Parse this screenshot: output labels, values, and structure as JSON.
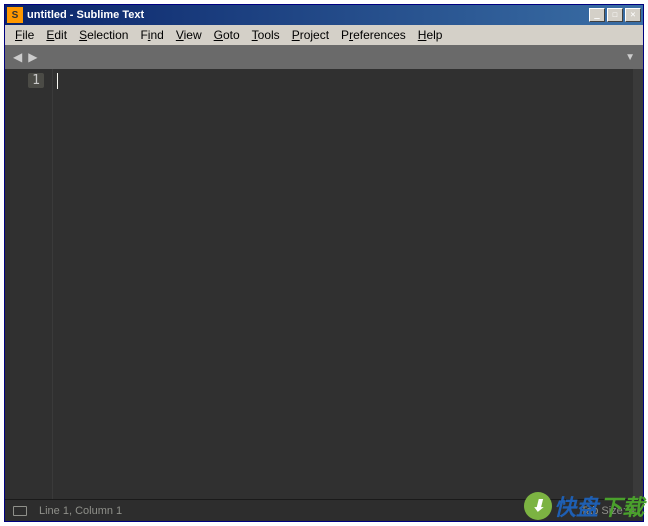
{
  "titlebar": {
    "text": "untitled - Sublime Text"
  },
  "menu": {
    "file": "File",
    "edit": "Edit",
    "selection": "Selection",
    "find": "Find",
    "view": "View",
    "goto": "Goto",
    "tools": "Tools",
    "project": "Project",
    "preferences": "Preferences",
    "help": "Help"
  },
  "gutter": {
    "line1": "1"
  },
  "status": {
    "position": "Line 1, Column 1",
    "tabsize": "Tab Size: 4"
  },
  "watermark": {
    "text1": "快盘",
    "text2": "下载"
  }
}
